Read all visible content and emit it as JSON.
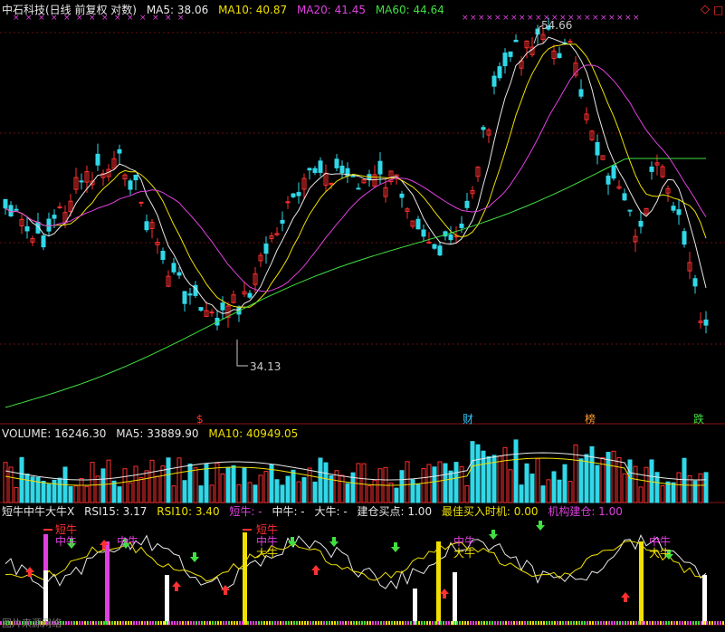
{
  "header": {
    "title": "中石科技(日线 前复权 对数)",
    "ma": [
      {
        "label": "MA5: 38.06",
        "color": "#e8e8e8"
      },
      {
        "label": "MA10: 40.87",
        "color": "#f0e000"
      },
      {
        "label": "MA20: 41.45",
        "color": "#e040e0"
      },
      {
        "label": "MA60: 44.64",
        "color": "#40e040"
      }
    ]
  },
  "price_chart": {
    "high_label": "54.66",
    "low_label": "34.13",
    "markers": [
      {
        "text": "$",
        "color": "#ff3030"
      },
      {
        "text": "财",
        "color": "#30c8ff"
      },
      {
        "text": "榜",
        "color": "#ff9a30"
      },
      {
        "text": "跌",
        "color": "#40e040"
      }
    ]
  },
  "volume_header": [
    {
      "label": "VOLUME: 16246.30",
      "color": "#e8e8e8"
    },
    {
      "label": "MA5: 33889.90",
      "color": "#e8e8e8"
    },
    {
      "label": "MA10: 40949.05",
      "color": "#f0e000"
    }
  ],
  "indicator_header": [
    {
      "label": "短牛中牛大牛X",
      "color": "#e8e8e8"
    },
    {
      "label": "RSI15: 3.17",
      "color": "#e8e8e8"
    },
    {
      "label": "RSI10: 3.40",
      "color": "#f0e000"
    },
    {
      "label": "短牛: -",
      "color": "#e040e0"
    },
    {
      "label": "中牛: -",
      "color": "#e8e8e8"
    },
    {
      "label": "大牛: -",
      "color": "#e8e8e8"
    },
    {
      "label": "建仓买点: 1.00",
      "color": "#e8e8e8"
    },
    {
      "label": "最佳买入时机: 0.00",
      "color": "#f0e000"
    },
    {
      "label": "机构建仓: 1.00",
      "color": "#e040e0"
    }
  ],
  "indicator_tags": [
    {
      "text": "短牛",
      "color": "#ff3030"
    },
    {
      "text": "中牛",
      "color": "#e040e0"
    },
    {
      "text": "中牛",
      "color": "#e040e0"
    },
    {
      "text": "短牛",
      "color": "#ff3030"
    },
    {
      "text": "中牛",
      "color": "#e040e0"
    },
    {
      "text": "大牛",
      "color": "#f0e000"
    },
    {
      "text": "中牛",
      "color": "#e040e0"
    },
    {
      "text": "大牛",
      "color": "#f0e000"
    },
    {
      "text": "中牛",
      "color": "#e040e0"
    },
    {
      "text": "大牛",
      "color": "#f0e000"
    }
  ],
  "watermark": "图片来源网络"
}
